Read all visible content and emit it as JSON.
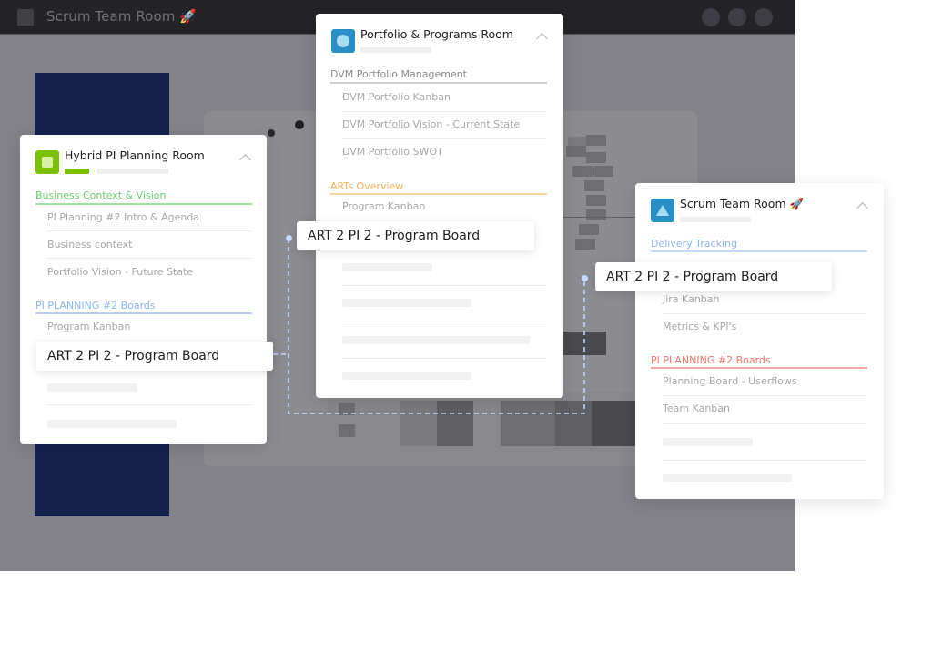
{
  "app": {
    "title": "Scrum Team Room 🚀",
    "window_controls": [
      "circle-button",
      "circle-button",
      "circle-button"
    ]
  },
  "colors": {
    "titlebar": "#242328",
    "backdrop": "#838288",
    "navy_panel": "#14214b",
    "green_accent": "#7bc100",
    "blue_accent": "#2a8fc4",
    "section_green": "#6ccf6c",
    "section_blue": "#8fb4f2",
    "section_orange": "#f7b15a",
    "section_red": "#f0786a",
    "connector": "#c6d8ff"
  },
  "cards": {
    "hybrid": {
      "title": "Hybrid PI Planning Room",
      "icon": "square-icon",
      "sections": [
        {
          "label": "Business Context & Vision",
          "color": "#6ccf6c",
          "items": [
            "PI Planning #2 Intro & Agenda",
            "Business context",
            "Portfolio Vision - Future State"
          ]
        },
        {
          "label": "PI PLANNING #2 Boards",
          "color": "#8fb4f2",
          "items": [
            "Program Kanban"
          ]
        }
      ],
      "floating_item": "ART 2 PI 2 - Program Board"
    },
    "portfolio": {
      "title": "Portfolio & Programs Room",
      "icon": "circle-icon",
      "sections": [
        {
          "label": "DVM Portfolio Management",
          "color": "#a0a0a0",
          "items": [
            "DVM Portfolio Kanban",
            "DVM Portfolio Vision - Current State",
            "DVM Portfolio SWOT"
          ]
        },
        {
          "label": "ARTs Overview",
          "color": "#f7b15a",
          "items": [
            "Program Kanban"
          ]
        }
      ],
      "floating_item": "ART 2 PI 2 - Program Board"
    },
    "scrum": {
      "title": "Scrum Team Room 🚀",
      "icon": "triangle-icon",
      "sections": [
        {
          "label": "Delivery Tracking",
          "color": "#8fb4f2",
          "items": [
            "Jira Kanban",
            "Metrics & KPI's"
          ]
        },
        {
          "label": "PI PLANNING #2 Boards",
          "color": "#f0786a",
          "items": [
            "Planning Board - Userflows",
            "Team Kanban"
          ]
        }
      ],
      "floating_item": "ART 2 PI 2 - Program Board"
    }
  }
}
